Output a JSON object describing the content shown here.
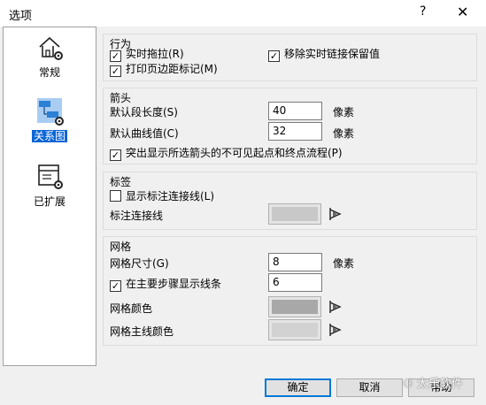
{
  "window": {
    "title": "选项",
    "help_glyph": "?",
    "close_glyph": "✕"
  },
  "sidebar": {
    "items": [
      {
        "label": "常规",
        "icon": "house-gear-icon"
      },
      {
        "label": "关系图",
        "icon": "relation-diagram-gear-icon",
        "selected": true
      },
      {
        "label": "已扩展",
        "icon": "extended-window-gear-icon"
      }
    ]
  },
  "behavior": {
    "title": "行为",
    "realtime_drag": {
      "label": "实时拖拉(R)",
      "checked": true
    },
    "remove_realtime_link": {
      "label": "移除实时链接保留值",
      "checked": true
    },
    "print_margin_marks": {
      "label": "打印页边距标记(M)",
      "checked": true
    }
  },
  "arrows": {
    "title": "箭头",
    "default_segment_length": {
      "label": "默认段长度(S)",
      "value": "40",
      "unit": "像素"
    },
    "default_curve": {
      "label": "默认曲线值(C)",
      "value": "32",
      "unit": "像素"
    },
    "highlight_invisible": {
      "label": "突出显示所选箭头的不可见起点和终点流程(P)",
      "checked": true
    }
  },
  "labels": {
    "title": "标签",
    "show_label_connector": {
      "label": "显示标注连接线(L)",
      "checked": false
    },
    "label_connector": {
      "label": "标注连接线",
      "color": "#c8c8c8"
    }
  },
  "grid": {
    "title": "网格",
    "grid_size": {
      "label": "网格尺寸(G)",
      "value": "8",
      "unit": "像素"
    },
    "show_lines_major": {
      "label": "在主要步骤显示线条",
      "checked": true,
      "value": "6"
    },
    "grid_color": {
      "label": "网格颜色",
      "color": "#a8a8a8"
    },
    "major_line_color": {
      "label": "网格主线颜色",
      "color": "#d2d2d2"
    }
  },
  "buttons": {
    "ok": "确定",
    "cancel": "取消",
    "help": "帮助"
  },
  "watermark": "太乐软件",
  "colors": {
    "accent": "#0078d7",
    "selection": "#0a64d6"
  }
}
